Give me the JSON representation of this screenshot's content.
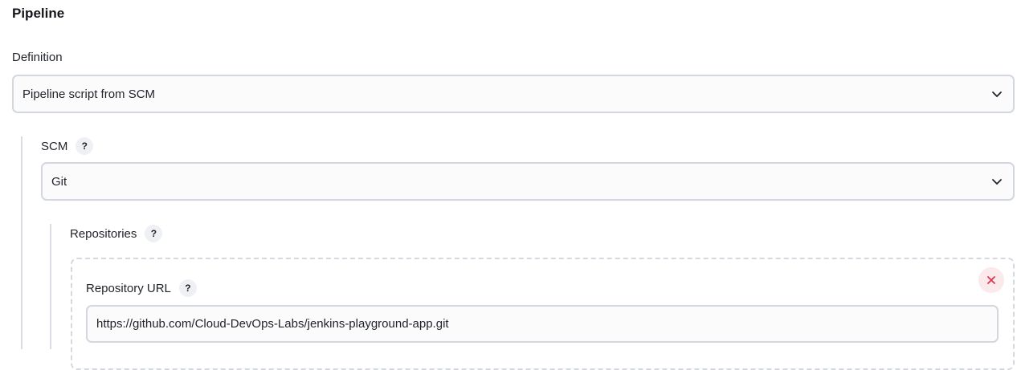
{
  "section": {
    "title": "Pipeline"
  },
  "definition": {
    "label": "Definition",
    "selected": "Pipeline script from SCM"
  },
  "scm": {
    "label": "SCM",
    "help": "?",
    "selected": "Git"
  },
  "repositories": {
    "label": "Repositories",
    "help": "?",
    "repository_url": {
      "label": "Repository URL",
      "help": "?",
      "value": "https://github.com/Cloud-DevOps-Labs/jenkins-playground-app.git"
    }
  },
  "colors": {
    "border": "#d3d7de",
    "help_bg": "#eef0f3",
    "delete_bg": "#fbe9ec",
    "delete_icon": "#e0364f"
  },
  "icons": {
    "select_chevron": "chevron-down-icon",
    "delete": "close-icon"
  }
}
